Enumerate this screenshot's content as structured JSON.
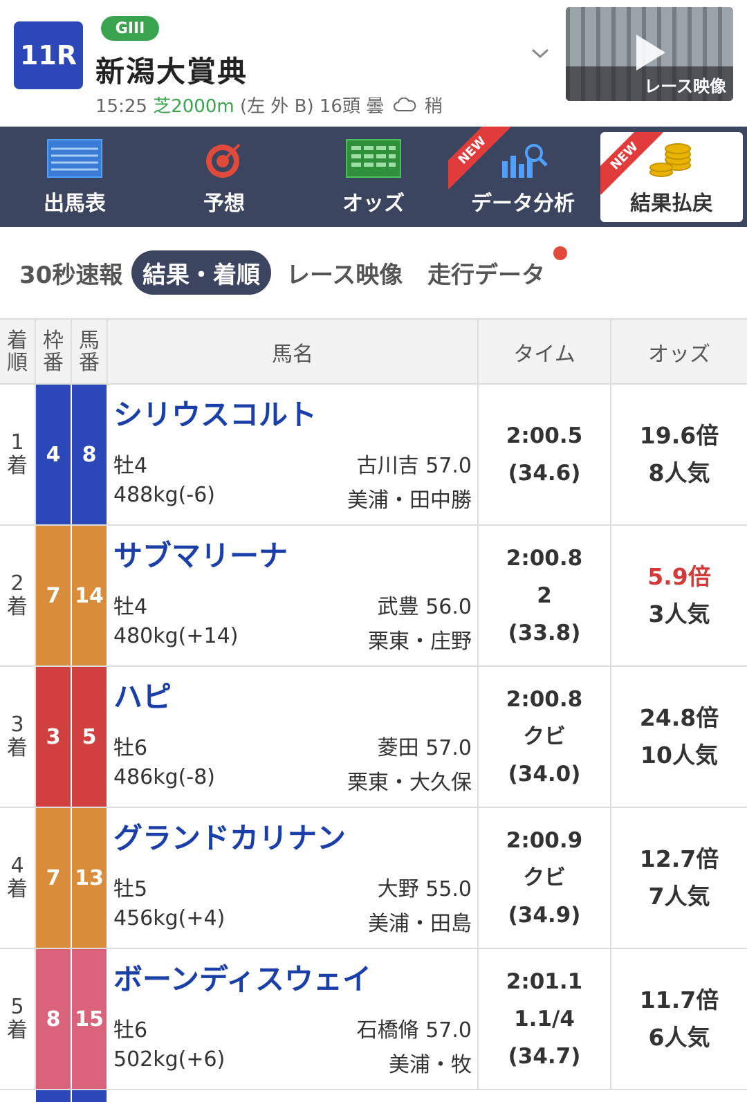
{
  "race": {
    "number": "11R",
    "grade": "GIII",
    "name": "新潟大賞典",
    "time": "15:25",
    "course": "芝2000m",
    "direction": "(左 外 B)",
    "heads": "16頭",
    "weather": "曇",
    "ground": "稍",
    "video_label": "レース映像"
  },
  "nav": {
    "items": [
      {
        "label": "出馬表",
        "icon": "race-card-icon",
        "new": false
      },
      {
        "label": "予想",
        "icon": "target-icon",
        "new": false
      },
      {
        "label": "オッズ",
        "icon": "odds-table-icon",
        "new": false
      },
      {
        "label": "データ分析",
        "icon": "chart-search-icon",
        "new": true
      },
      {
        "label": "結果払戻",
        "icon": "coins-icon",
        "new": true,
        "active": true
      }
    ],
    "new_label": "NEW"
  },
  "tabs": [
    "30秒速報",
    "結果・着順",
    "レース映像",
    "走行データ"
  ],
  "active_tab": "結果・着順",
  "table": {
    "headers": {
      "rank": [
        "着",
        "順"
      ],
      "waku": [
        "枠",
        "番"
      ],
      "uma": [
        "馬",
        "番"
      ],
      "name": "馬名",
      "time": "タイム",
      "odds": "オッズ"
    },
    "rank_suffix": "着",
    "rows": [
      {
        "rank": "1",
        "waku": "4",
        "uma": "8",
        "color": "#2c47b8",
        "name": "シリウスコルト",
        "sexage": "牡4",
        "weight": "488kg(-6)",
        "jockey": "古川吉 57.0",
        "trainer": "美浦・田中勝",
        "time": "2:00.5",
        "margin": "",
        "last3f": "(34.6)",
        "odds": "19.6倍",
        "fav": false,
        "pop": "8人気"
      },
      {
        "rank": "2",
        "waku": "7",
        "uma": "14",
        "color": "#d98c3a",
        "name": "サブマリーナ",
        "sexage": "牡4",
        "weight": "480kg(+14)",
        "jockey": "武豊 56.0",
        "trainer": "栗東・庄野",
        "time": "2:00.8",
        "margin": "2",
        "last3f": "(33.8)",
        "odds": "5.9倍",
        "fav": true,
        "pop": "3人気"
      },
      {
        "rank": "3",
        "waku": "3",
        "uma": "5",
        "color": "#d04040",
        "name": "ハピ",
        "sexage": "牡6",
        "weight": "486kg(-8)",
        "jockey": "菱田 57.0",
        "trainer": "栗東・大久保",
        "time": "2:00.8",
        "margin": "クビ",
        "last3f": "(34.0)",
        "odds": "24.8倍",
        "fav": false,
        "pop": "10人気"
      },
      {
        "rank": "4",
        "waku": "7",
        "uma": "13",
        "color": "#d98c3a",
        "name": "グランドカリナン",
        "sexage": "牡5",
        "weight": "456kg(+4)",
        "jockey": "大野 55.0",
        "trainer": "美浦・田島",
        "time": "2:00.9",
        "margin": "クビ",
        "last3f": "(34.9)",
        "odds": "12.7倍",
        "fav": false,
        "pop": "7人気"
      },
      {
        "rank": "5",
        "waku": "8",
        "uma": "15",
        "color": "#d8637a",
        "name": "ボーンディスウェイ",
        "sexage": "牡6",
        "weight": "502kg(+6)",
        "jockey": "石橋脩 57.0",
        "trainer": "美浦・牧",
        "time": "2:01.1",
        "margin": "1.1/4",
        "last3f": "(34.7)",
        "odds": "11.7倍",
        "fav": false,
        "pop": "6人気"
      }
    ]
  }
}
